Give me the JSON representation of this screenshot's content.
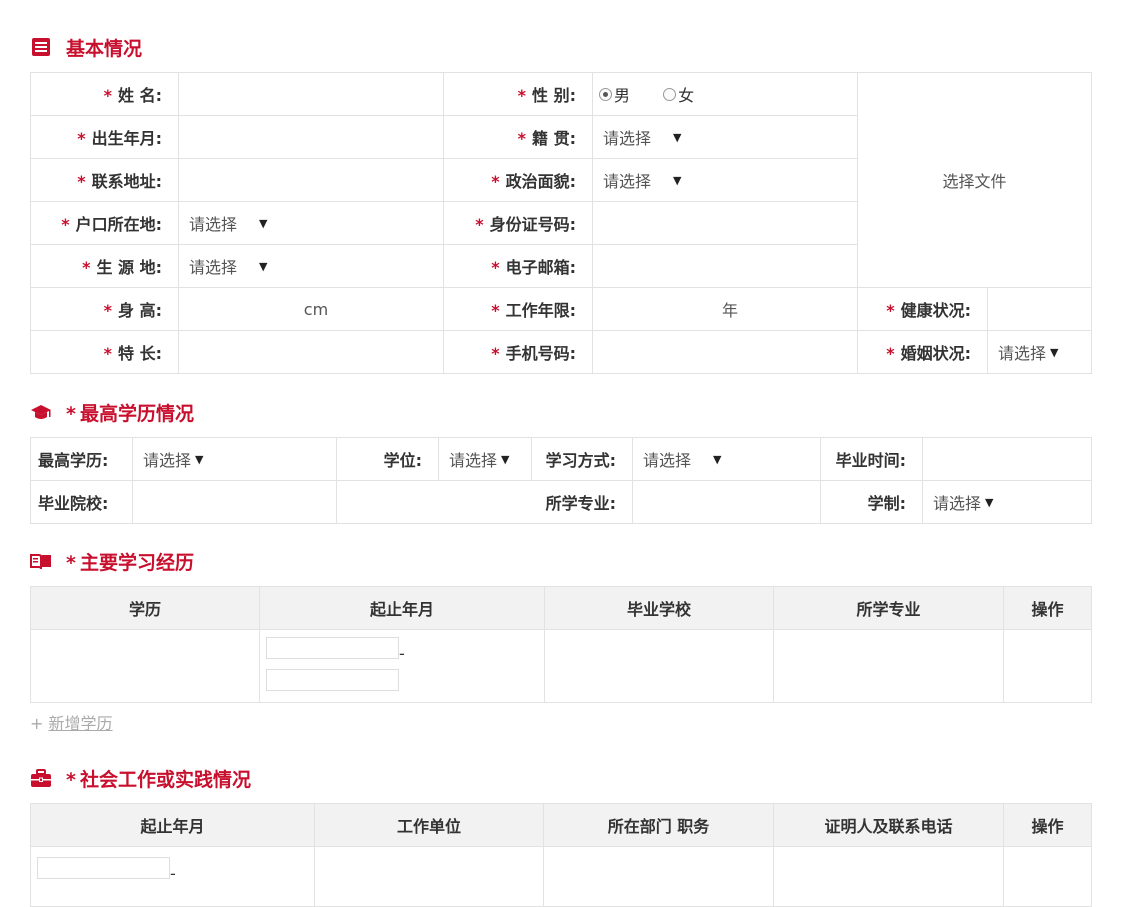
{
  "basic": {
    "title": "基本情况",
    "name_label": "姓 名:",
    "gender_label": "性 别:",
    "gender_options": [
      "男",
      "女"
    ],
    "birth_label": "出生年月:",
    "native_label": "籍 贯:",
    "address_label": "联系地址:",
    "political_label": "政治面貌:",
    "hukou_label": "户口所在地:",
    "idcard_label": "身份证号码:",
    "origin_label": "生 源 地:",
    "email_label": "电子邮箱:",
    "height_label": "身 高:",
    "height_unit": "cm",
    "workyears_label": "工作年限:",
    "workyears_unit": "年",
    "health_label": "健康状况:",
    "specialty_label": "特 长:",
    "phone_label": "手机号码:",
    "marital_label": "婚姻状况:",
    "select_placeholder": "请选择",
    "file_button": "选择文件",
    "required_mark": "*"
  },
  "education": {
    "title": "最高学历情况",
    "degree_level_label": "最高学历:",
    "degree_label": "学位:",
    "study_mode_label": "学习方式:",
    "grad_time_label": "毕业时间:",
    "school_label": "毕业院校:",
    "major_label": "所学专业:",
    "duration_label": "学制:"
  },
  "study_history": {
    "title": "主要学习经历",
    "columns": [
      "学历",
      "起止年月",
      "毕业学校",
      "所学专业",
      "操作"
    ],
    "date_sep": "-",
    "add_prefix": "+",
    "add_label": "新增学历"
  },
  "work_history": {
    "title": "社会工作或实践情况",
    "columns": [
      "起止年月",
      "工作单位",
      "所在部门 职务",
      "证明人及联系电话",
      "操作"
    ],
    "date_sep": "-"
  },
  "colors": {
    "accent": "#c8102e",
    "header_bg": "#f2f2f2",
    "border": "#e2e2e2"
  }
}
